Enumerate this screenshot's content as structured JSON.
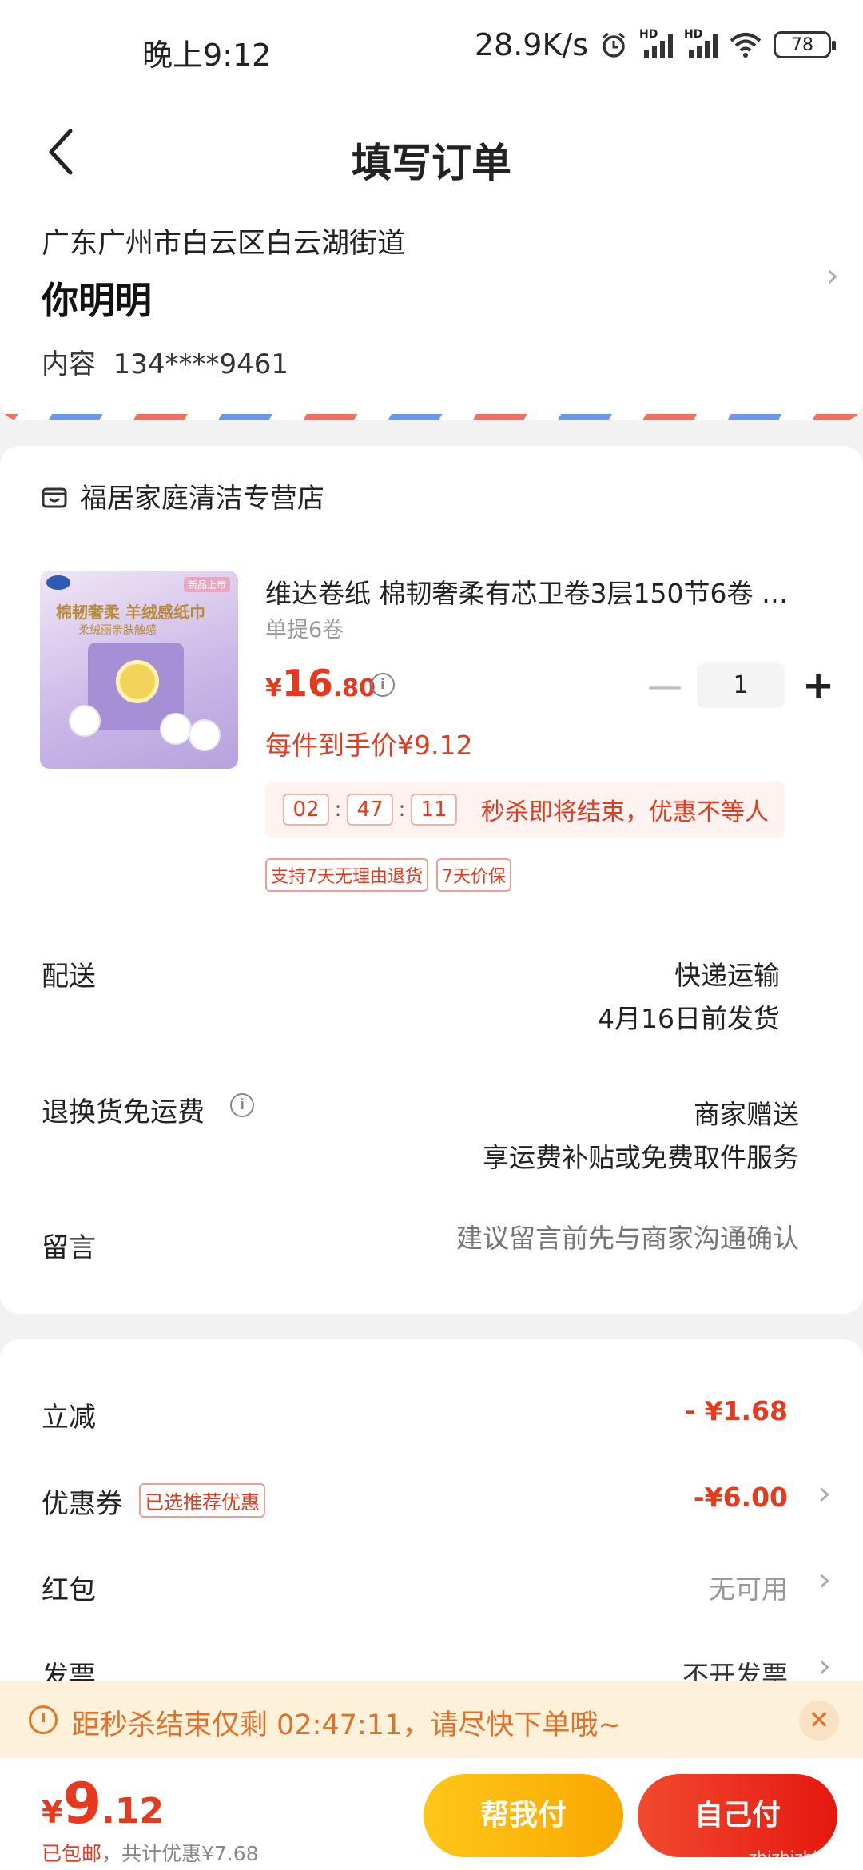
{
  "status_bar": {
    "time": "晚上9:12",
    "speed": "28.9K/s",
    "sim1": "HD",
    "sim2": "HD",
    "battery": "78"
  },
  "header": {
    "title": "填写订单",
    "back_icon": "back-arrow-icon"
  },
  "address": {
    "region": "广东广州市白云区白云湖街道",
    "name": "你明明",
    "phone_label": "内容",
    "phone": "134****9461"
  },
  "shop": {
    "name": "福居家庭清洁专营店",
    "icon": "store-icon"
  },
  "product": {
    "image_logo": "Vinda",
    "image_tag": "新品上市",
    "image_line1": "棉韧奢柔 羊绒感纸巾",
    "image_line2": "柔绒丽亲肤触感",
    "title": "维达卷纸 棉韧奢柔有芯卫卷3层150节6卷 …",
    "spec": "单提6卷",
    "price_currency": "¥",
    "price_int": "16",
    "price_dec": ".80",
    "deal_price": "每件到手价¥9.12",
    "quantity": "1",
    "minus": "—",
    "plus": "+"
  },
  "countdown": {
    "hh": "02",
    "mm": "47",
    "ss": "11",
    "sep": ":",
    "message": "秒杀即将结束，优惠不等人"
  },
  "service_tags": [
    "支持7天无理由退货",
    "7天价保"
  ],
  "shipping": {
    "label": "配送",
    "method": "快递运输",
    "date": "4月16日前发货"
  },
  "return_shipping": {
    "label": "退换货免运费",
    "value1": "商家赠送",
    "value2": "享运费补贴或免费取件服务"
  },
  "message": {
    "label": "留言",
    "placeholder": "建议留言前先与商家沟通确认"
  },
  "discounts": {
    "instant_label": "立减",
    "instant_value": "- ¥1.68",
    "coupon_label": "优惠券",
    "coupon_tag": "已选推荐优惠",
    "coupon_value": "-¥6.00",
    "redpacket_label": "红包",
    "redpacket_value": "无可用",
    "invoice_label": "发票",
    "invoice_value": "不开发票"
  },
  "flash_banner": {
    "text": "距秒杀结束仅剩 02:47:11，请尽快下单哦~",
    "close": "✕"
  },
  "bottom": {
    "currency": "¥",
    "total_int": "9",
    "total_dec": ".12",
    "free_shipping": "已包邮",
    "saving": "，共计优惠¥7.68",
    "help_pay": "帮我付",
    "self_pay": "自己付",
    "watermark": "zhizhizhi.com"
  },
  "colors": {
    "accent_red": "#e53a1e",
    "accent_yellow": "#f9a800",
    "banner_bg": "#fdf1da"
  }
}
